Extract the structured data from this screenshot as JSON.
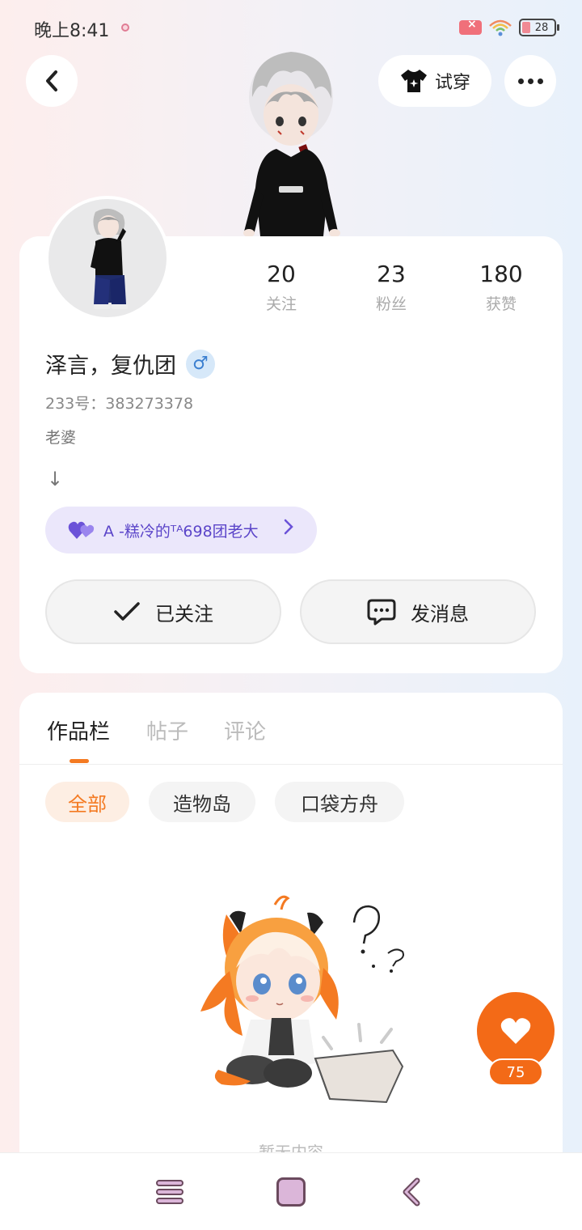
{
  "status_bar": {
    "time": "晚上8:41",
    "battery": "28"
  },
  "header": {
    "tryon_label": "试穿"
  },
  "stats": [
    {
      "value": "20",
      "label": "关注"
    },
    {
      "value": "23",
      "label": "粉丝"
    },
    {
      "value": "180",
      "label": "获赞"
    }
  ],
  "profile": {
    "name": "泽言，复仇团",
    "gender_symbol": "♂",
    "user_id": "233号：383273378",
    "bio": "老婆",
    "bio_arrow": "↓",
    "team_label": "A -糕冷的ᵀᴬ698团老大"
  },
  "actions": {
    "follow_label": "已关注",
    "message_label": "发消息"
  },
  "tabs": [
    {
      "label": "作品栏",
      "active": true
    },
    {
      "label": "帖子",
      "active": false
    },
    {
      "label": "评论",
      "active": false
    }
  ],
  "filters": [
    {
      "label": "全部",
      "active": true
    },
    {
      "label": "造物岛",
      "active": false
    },
    {
      "label": "口袋方舟",
      "active": false
    }
  ],
  "empty_state": {
    "text": "暂无内容"
  },
  "like": {
    "count": "75"
  },
  "colors": {
    "accent": "#f47a22",
    "team": "#6b52d8"
  }
}
